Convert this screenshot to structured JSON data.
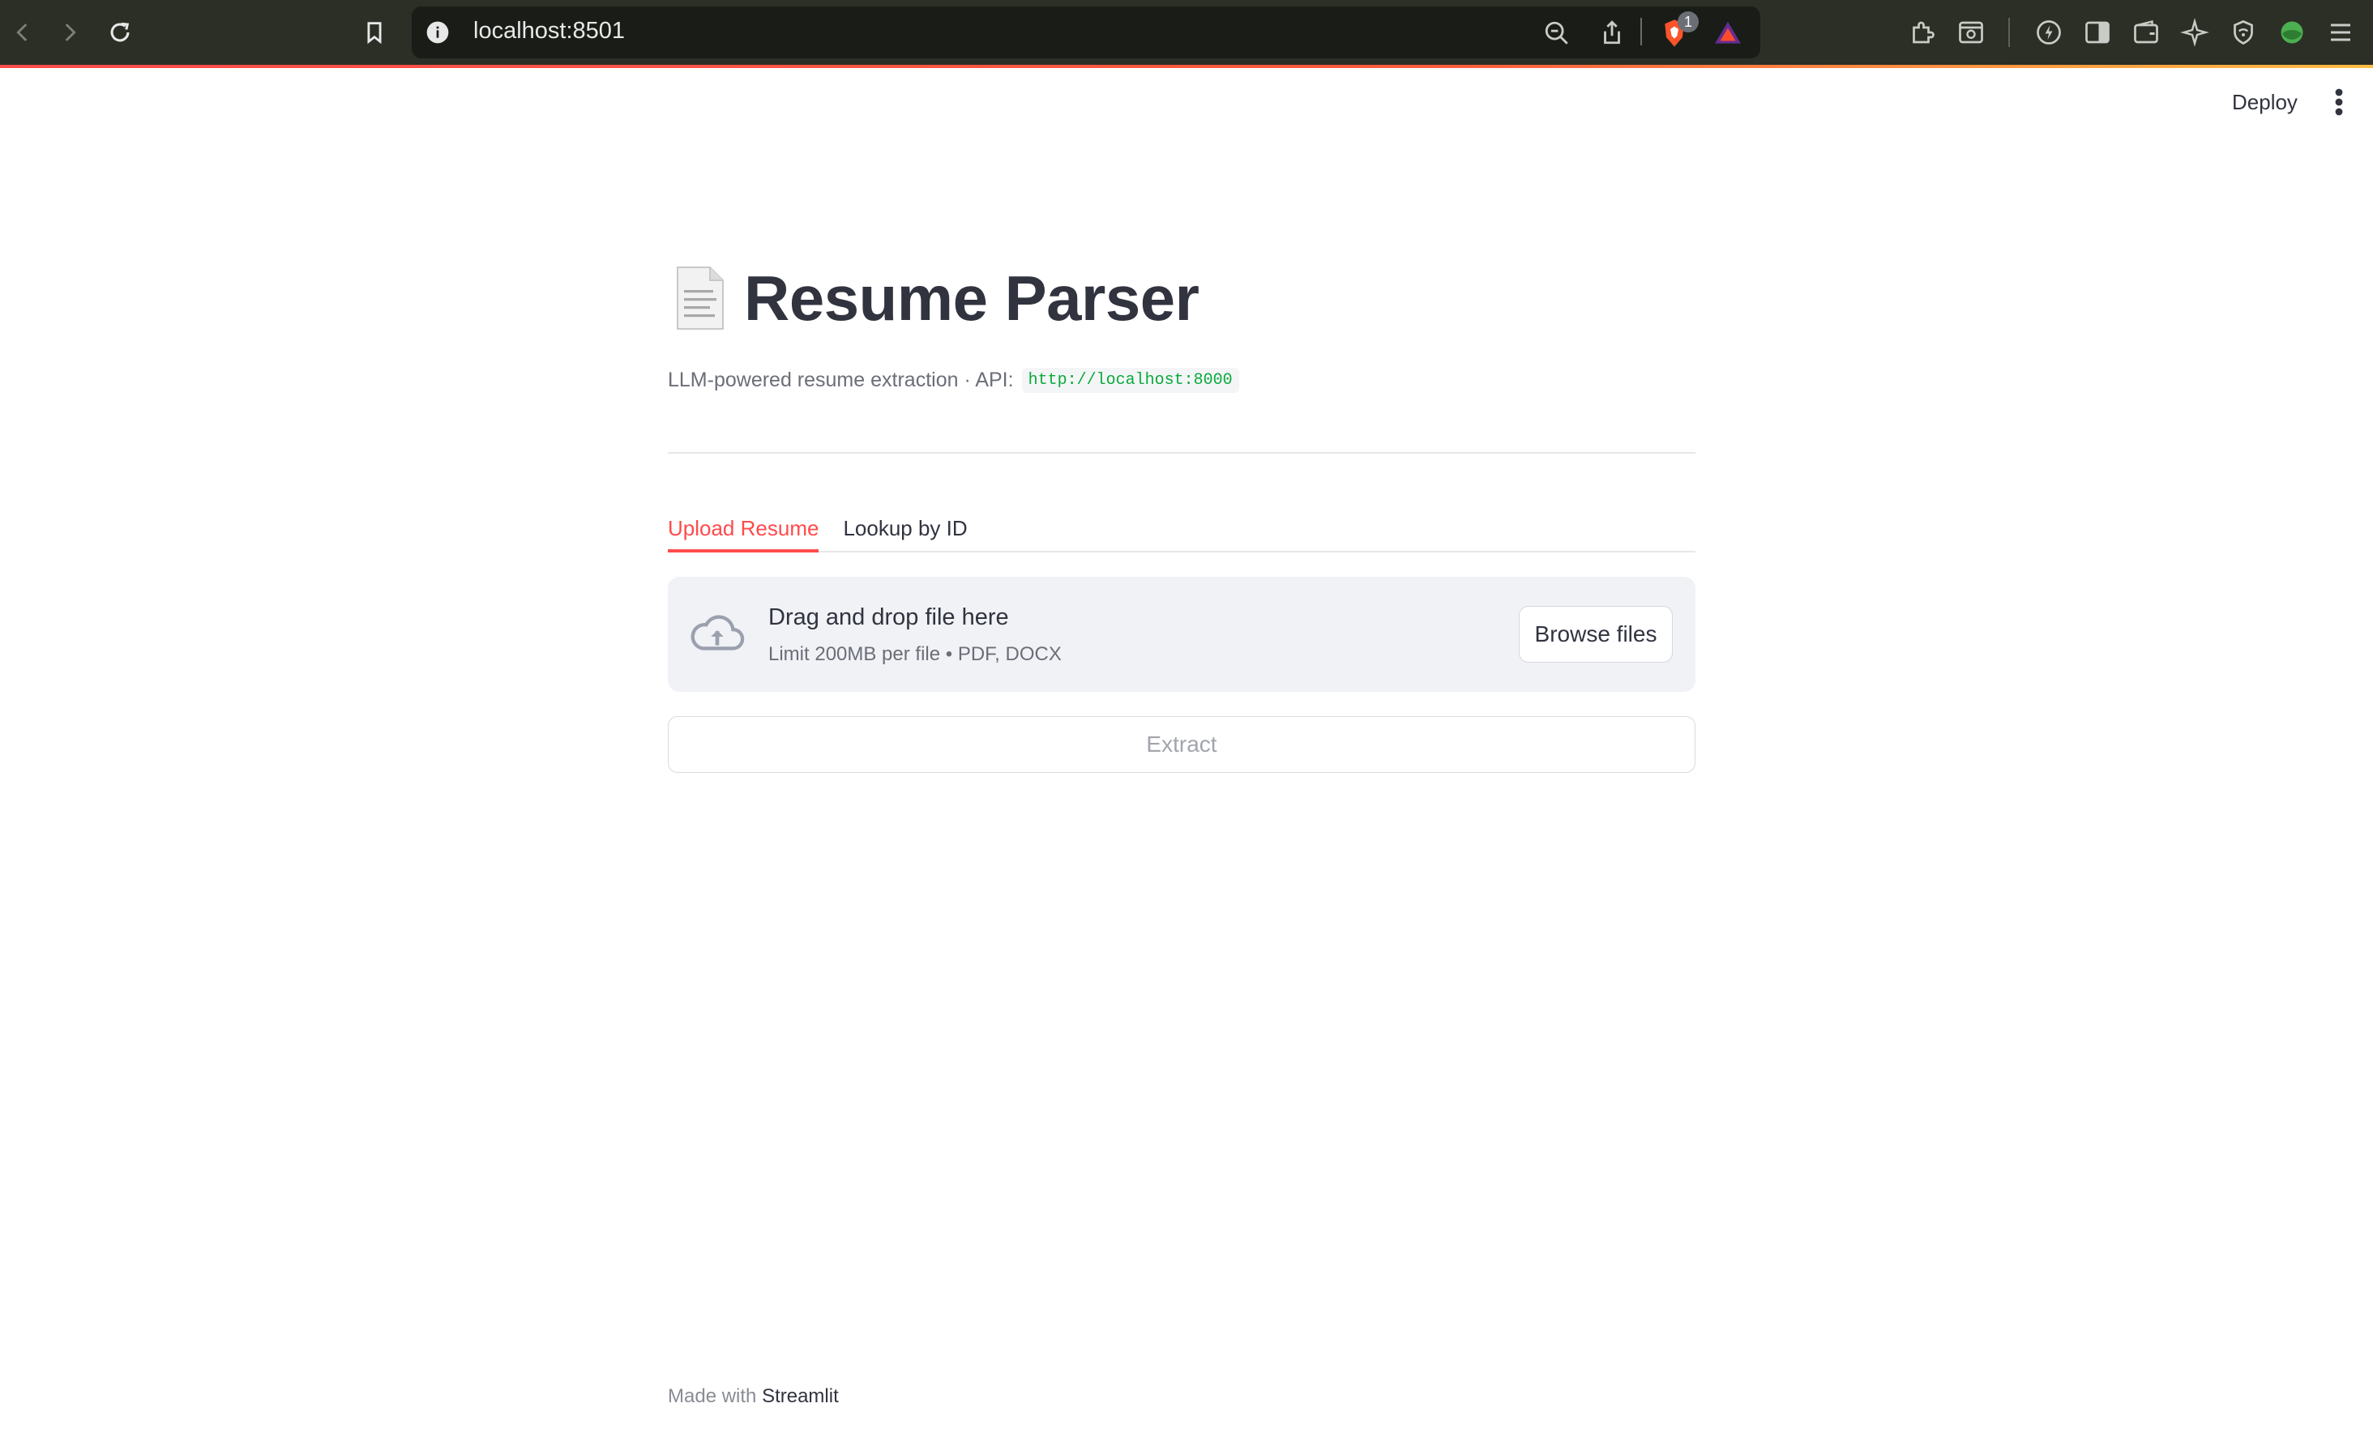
{
  "browser": {
    "url": "localhost:8501",
    "shields_badge": "1"
  },
  "header": {
    "deploy_label": "Deploy"
  },
  "main": {
    "title": "Resume Parser",
    "caption_prefix": "LLM-powered resume extraction · API:",
    "api_url": "http://localhost:8000",
    "tabs": [
      {
        "label": "Upload Resume",
        "active": true
      },
      {
        "label": "Lookup by ID",
        "active": false
      }
    ],
    "uploader": {
      "title": "Drag and drop file here",
      "subtitle": "Limit 200MB per file • PDF, DOCX",
      "browse_label": "Browse files"
    },
    "extract_label": "Extract"
  },
  "footer": {
    "prefix": "Made with",
    "brand": "Streamlit"
  },
  "colors": {
    "accent": "#ff4b4b",
    "text": "#31333f",
    "code": "#09ab3b",
    "dropzone_bg": "#f0f2f6"
  }
}
